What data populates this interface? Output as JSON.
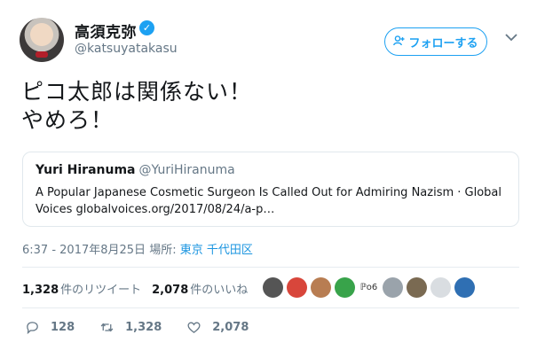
{
  "author": {
    "display_name": "高須克弥",
    "handle": "@katsuyatakasu",
    "verified_mark": "✓"
  },
  "follow_button": {
    "label": "フォローする",
    "icon": "add-user-icon"
  },
  "tweet": {
    "line1": "ピコ太郎は関係ない！",
    "line2": "やめろ！"
  },
  "quoted_tweet": {
    "author_name": "Yuri Hiranuma",
    "author_handle": "@YuriHiranuma",
    "text": "A Popular Japanese Cosmetic Surgeon Is Called Out for Admiring Nazism · Global Voices globalvoices.org/2017/08/24/a-p…"
  },
  "meta": {
    "timestamp": "6:37 - 2017年8月25日",
    "location_label": "場所:",
    "location": "東京 千代田区"
  },
  "stats": {
    "retweets_count": "1,328",
    "retweets_label": "件のリツイート",
    "likes_count": "2,078",
    "likes_label": "件のいいね"
  },
  "likers": [
    {
      "color": "#555555",
      "text": ""
    },
    {
      "color": "#d8463b",
      "text": ""
    },
    {
      "color": "#b87d52",
      "text": ""
    },
    {
      "color": "#38a34a",
      "text": ""
    },
    {
      "color": "#ffffff",
      "text": "ℙo6"
    },
    {
      "color": "#9aa3ab",
      "text": ""
    },
    {
      "color": "#7a6a52",
      "text": ""
    },
    {
      "color": "#d9dde1",
      "text": ""
    },
    {
      "color": "#2f6fb3",
      "text": ""
    }
  ],
  "actions": {
    "replies": "128",
    "retweets": "1,328",
    "likes": "2,078"
  }
}
